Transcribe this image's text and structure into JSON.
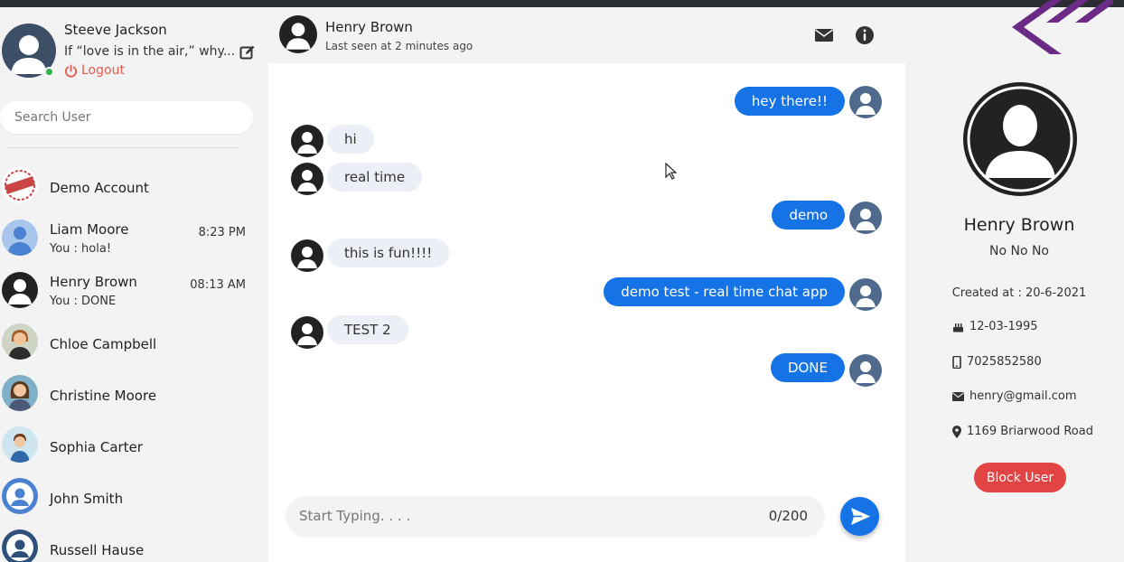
{
  "current_user": {
    "name": "Steeve Jackson",
    "status": "If “love is in the air,” why...",
    "logout_label": "Logout"
  },
  "search": {
    "placeholder": "Search User"
  },
  "contacts": [
    {
      "name": "Demo Account",
      "last": "",
      "time": "",
      "avatar": "sample-stamp"
    },
    {
      "name": "Liam Moore",
      "last": "You : hola!",
      "time": "8:23 PM",
      "avatar": "default-light"
    },
    {
      "name": "Henry Brown",
      "last": "You : DONE",
      "time": "08:13 AM",
      "avatar": "default-dark"
    },
    {
      "name": "Chloe Campbell",
      "last": "",
      "time": "",
      "avatar": "woman-1"
    },
    {
      "name": "Christine Moore",
      "last": "",
      "time": "",
      "avatar": "woman-2"
    },
    {
      "name": "Sophia Carter",
      "last": "",
      "time": "",
      "avatar": "woman-3"
    },
    {
      "name": "John Smith",
      "last": "",
      "time": "",
      "avatar": "default-blue"
    },
    {
      "name": "Russell Hause",
      "last": "",
      "time": "",
      "avatar": "default-navy"
    }
  ],
  "chat": {
    "name": "Henry Brown",
    "last_seen": "Last seen at 2 minutes ago",
    "messages": [
      {
        "text": "hey there!!",
        "direction": "out"
      },
      {
        "text": "hi",
        "direction": "in"
      },
      {
        "text": "real time",
        "direction": "in"
      },
      {
        "text": "demo",
        "direction": "out"
      },
      {
        "text": "this is fun!!!!",
        "direction": "in"
      },
      {
        "text": "demo test - real time chat app",
        "direction": "out"
      },
      {
        "text": "TEST 2",
        "direction": "in"
      },
      {
        "text": "DONE",
        "direction": "out"
      }
    ],
    "composer": {
      "placeholder": "Start Typing. . . .",
      "counter": "0/200"
    }
  },
  "profile": {
    "name": "Henry Brown",
    "bio": "No No No",
    "created": "Created at : 20-6-2021",
    "birthday": "12-03-1995",
    "phone": "7025852580",
    "email": "henry@gmail.com",
    "address": "1169 Briarwood Road",
    "block_label": "Block User"
  },
  "colors": {
    "primary": "#1673e6",
    "danger": "#e24343",
    "logout": "#e55a4e",
    "online": "#2fb34a",
    "logo": "#6a2a86"
  }
}
